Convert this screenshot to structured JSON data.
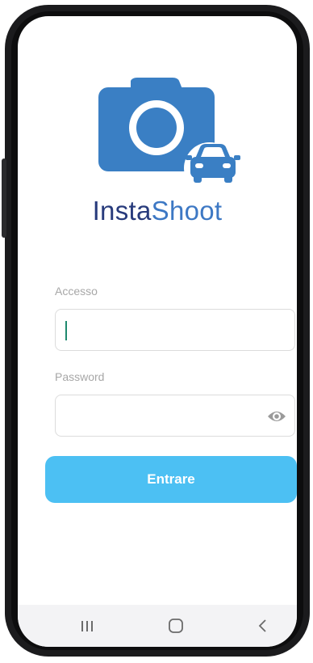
{
  "app": {
    "title_part_a": "Insta",
    "title_part_b": "Shoot",
    "logo_icon": "camera-car-icon"
  },
  "login": {
    "username_label": "Accesso",
    "username_value": "",
    "password_label": "Password",
    "password_value": "",
    "show_password_icon": "eye-icon",
    "submit_label": "Entrare"
  },
  "nav": {
    "recent_icon": "recent-apps-icon",
    "home_icon": "home-icon",
    "back_icon": "back-icon"
  },
  "colors": {
    "brand_dark": "#283b7c",
    "brand_light": "#3d78c4",
    "logo_blue": "#3a7fc4",
    "button": "#4cc0f3",
    "caret": "#1e8a6e"
  }
}
